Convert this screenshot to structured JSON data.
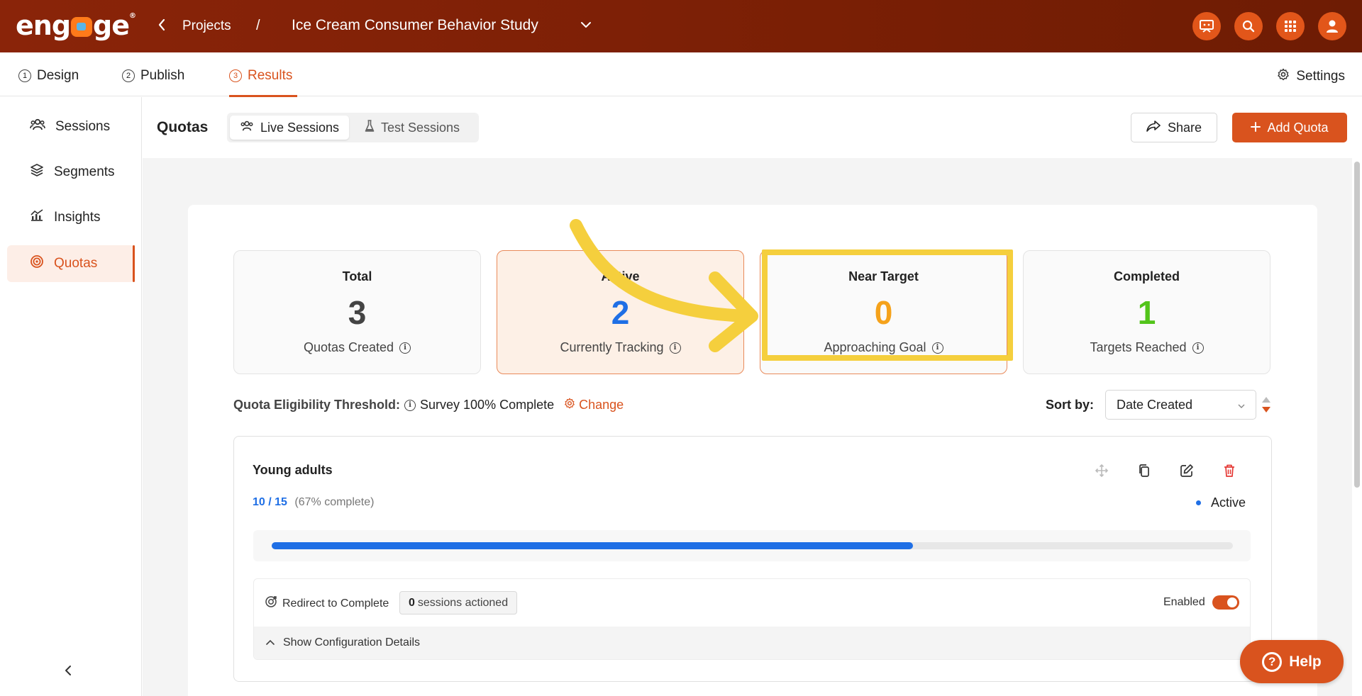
{
  "topbar": {
    "logo": "engage",
    "logo_mark": "®",
    "breadcrumb_projects": "Projects",
    "breadcrumb_sep": "/",
    "project_title": "Ice Cream Consumer Behavior Study",
    "icons": [
      "presentation-icon",
      "search-icon",
      "apps-grid-icon",
      "user-icon"
    ]
  },
  "steps": [
    {
      "num": "1",
      "label": "Design"
    },
    {
      "num": "2",
      "label": "Publish"
    },
    {
      "num": "3",
      "label": "Results"
    }
  ],
  "settings_label": "Settings",
  "sidebar": {
    "items": [
      {
        "label": "Sessions"
      },
      {
        "label": "Segments"
      },
      {
        "label": "Insights"
      },
      {
        "label": "Quotas"
      }
    ]
  },
  "header": {
    "title": "Quotas",
    "seg_live": "Live Sessions",
    "seg_test": "Test Sessions",
    "share": "Share",
    "add_quota": "Add Quota"
  },
  "stats": [
    {
      "label": "Total",
      "value": "3",
      "sub": "Quotas Created",
      "color": "#444444"
    },
    {
      "label": "Active",
      "value": "2",
      "sub": "Currently Tracking",
      "color": "#1f6fe5"
    },
    {
      "label": "Near Target",
      "value": "0",
      "sub": "Approaching Goal",
      "color": "#f5a21b"
    },
    {
      "label": "Completed",
      "value": "1",
      "sub": "Targets Reached",
      "color": "#52c41a"
    }
  ],
  "threshold": {
    "label": "Quota Eligibility Threshold:",
    "value": "Survey 100% Complete",
    "change": "Change"
  },
  "sort": {
    "label": "Sort by:",
    "value": "Date Created"
  },
  "quota": {
    "name": "Young adults",
    "progress_text": "10 / 15",
    "percent_text": "(67% complete)",
    "progress_fraction": 0.667,
    "status": "Active",
    "redirect_label": "Redirect to Complete",
    "sessions_count": "0",
    "sessions_suffix": "sessions actioned",
    "enabled_label": "Enabled",
    "config_label": "Show Configuration Details"
  },
  "help": {
    "symbol": "?",
    "label": "Help"
  }
}
